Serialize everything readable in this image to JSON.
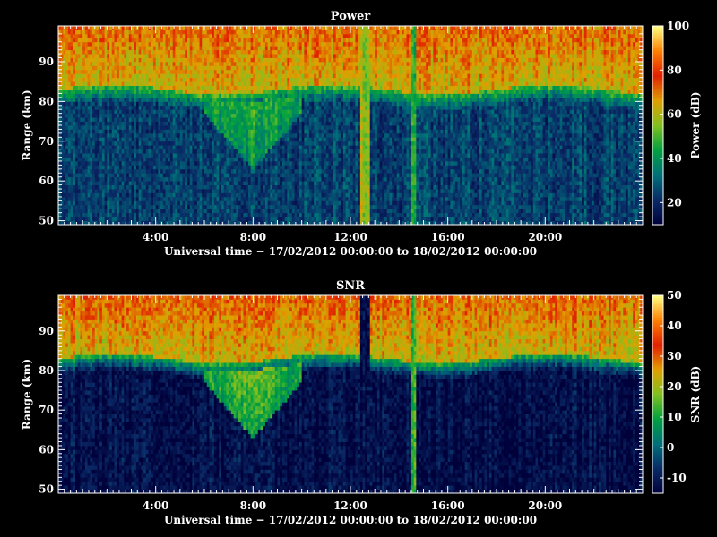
{
  "chart_data": [
    {
      "type": "heatmap",
      "title": "Power",
      "xlabel": "Universal time − 17/02/2012 00:00:00 to 18/02/2012 00:00:00",
      "ylabel": "Range (km)",
      "xlim_hours": [
        0,
        24
      ],
      "ylim": [
        49,
        99
      ],
      "x_ticks": [
        {
          "hour": 4,
          "label": "4:00"
        },
        {
          "hour": 8,
          "label": "8:00"
        },
        {
          "hour": 12,
          "label": "12:00"
        },
        {
          "hour": 16,
          "label": "16:00"
        },
        {
          "hour": 20,
          "label": "20:00"
        }
      ],
      "y_ticks": [
        50,
        60,
        70,
        80,
        90
      ],
      "colorbar": {
        "label": "Power (dB)",
        "min": 10,
        "max": 100,
        "ticks": [
          20,
          40,
          60,
          80,
          100
        ]
      },
      "profile": {
        "low_range_level": 25,
        "transition_km": 81,
        "high_range_level": 62,
        "top_range_level": 72
      },
      "features": [
        {
          "hour_start": 6.0,
          "hour_end": 10.0,
          "effect": "enhanced lower layer, descending to ~63 km",
          "level": 40
        },
        {
          "hour_start": 12.4,
          "hour_end": 12.8,
          "effect": "narrow vertical stripe",
          "level": 58
        },
        {
          "hour_start": 14.5,
          "hour_end": 14.7,
          "effect": "narrow vertical stripe",
          "level": 45
        }
      ]
    },
    {
      "type": "heatmap",
      "title": "SNR",
      "xlabel": "Universal time − 17/02/2012 00:00:00 to 18/02/2012 00:00:00",
      "ylabel": "Range (km)",
      "xlim_hours": [
        0,
        24
      ],
      "ylim": [
        49,
        99
      ],
      "x_ticks": [
        {
          "hour": 4,
          "label": "4:00"
        },
        {
          "hour": 8,
          "label": "8:00"
        },
        {
          "hour": 12,
          "label": "12:00"
        },
        {
          "hour": 16,
          "label": "16:00"
        },
        {
          "hour": 20,
          "label": "20:00"
        }
      ],
      "y_ticks": [
        50,
        60,
        70,
        80,
        90
      ],
      "colorbar": {
        "label": "SNR (dB)",
        "min": -15,
        "max": 50,
        "ticks": [
          -10,
          0,
          10,
          20,
          30,
          40,
          50
        ]
      },
      "profile": {
        "low_range_level": -12,
        "transition_km": 81,
        "high_range_level": 22,
        "top_range_level": 30
      },
      "features": [
        {
          "hour_start": 6.0,
          "hour_end": 10.0,
          "effect": "enhanced lower layer, descending to ~63 km",
          "level": 8
        },
        {
          "hour_start": 12.4,
          "hour_end": 12.8,
          "effect": "low SNR gap",
          "level": -12
        },
        {
          "hour_start": 14.5,
          "hour_end": 14.7,
          "effect": "narrow vertical stripe",
          "level": 15
        }
      ]
    }
  ],
  "colors": {
    "background": "#000000",
    "axis": "#ffffff",
    "colormap": [
      "#00003a",
      "#0a2a66",
      "#00707a",
      "#00a040",
      "#80c020",
      "#e0a000",
      "#e02000",
      "#ff8000",
      "#ffff80"
    ]
  }
}
